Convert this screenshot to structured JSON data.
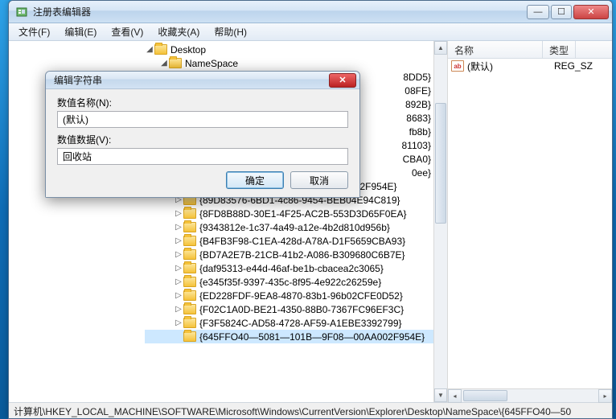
{
  "app": {
    "title": "注册表编辑器"
  },
  "menu": {
    "file": "文件(F)",
    "edit": "编辑(E)",
    "view": "查看(V)",
    "fav": "收藏夹(A)",
    "help": "帮助(H)"
  },
  "tree": {
    "desktop": "Desktop",
    "namespace": "NameSpace",
    "obscured": [
      "8DD5}",
      "08FE}",
      "892B}",
      "8683}",
      "fb8b}",
      "81103}",
      "CBA0}",
      "0ee}"
    ],
    "items": [
      "{645FF040-5081-101B-9F08-00AA002F954E}",
      "{89D83576-6BD1-4c86-9454-BEB04E94C819}",
      "{8FD8B88D-30E1-4F25-AC2B-553D3D65F0EA}",
      "{9343812e-1c37-4a49-a12e-4b2d810d956b}",
      "{B4FB3F98-C1EA-428d-A78A-D1F5659CBA93}",
      "{BD7A2E7B-21CB-41b2-A086-B309680C6B7E}",
      "{daf95313-e44d-46af-be1b-cbacea2c3065}",
      "{e345f35f-9397-435c-8f95-4e922c26259e}",
      "{ED228FDF-9EA8-4870-83b1-96b02CFE0D52}",
      "{F02C1A0D-BE21-4350-88B0-7367FC96EF3C}",
      "{F3F5824C-AD58-4728-AF59-A1EBE3392799}",
      "{645FFO40—5081—101B—9F08—00AA002F954E}"
    ]
  },
  "list": {
    "col_name": "名称",
    "col_type": "类型",
    "row_name": "(默认)",
    "row_type": "REG_SZ",
    "icon_text": "ab"
  },
  "dialog": {
    "title": "编辑字符串",
    "name_label": "数值名称(N):",
    "name_value": "(默认)",
    "data_label": "数值数据(V):",
    "data_value": "回收站",
    "ok": "确定",
    "cancel": "取消"
  },
  "status": {
    "path": "计算机\\HKEY_LOCAL_MACHINE\\SOFTWARE\\Microsoft\\Windows\\CurrentVersion\\Explorer\\Desktop\\NameSpace\\{645FFO40—50"
  }
}
